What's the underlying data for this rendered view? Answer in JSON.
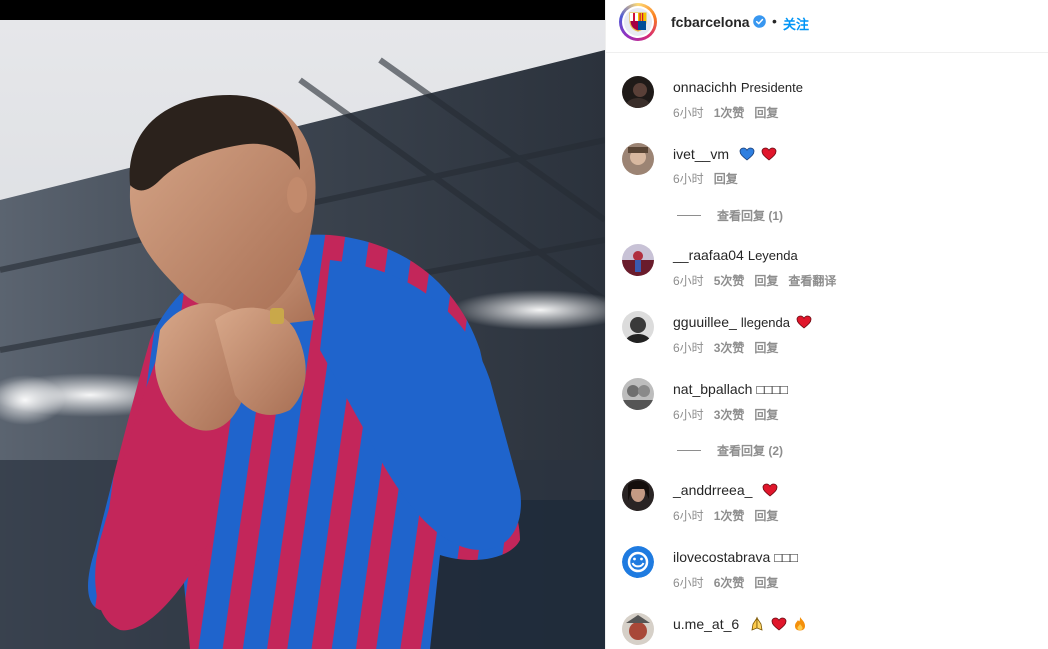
{
  "post": {
    "account": "fcbarcelona",
    "dot": "•",
    "follow_label": "关注"
  },
  "comments": [
    {
      "user": "onnacichh",
      "text": "Presidente",
      "time": "6小时",
      "likes": "1次赞",
      "reply": "回复",
      "avatar_color": "#2b2b2b"
    },
    {
      "user": "ivet__vm",
      "text": "",
      "emojis": [
        "blue-heart",
        "red-heart"
      ],
      "time": "6小时",
      "reply": "回复",
      "avatar_color": "#8a7060",
      "view_replies": "查看回复 (1)"
    },
    {
      "user": "__raafaa04",
      "text": "Leyenda",
      "time": "6小时",
      "likes": "5次赞",
      "reply": "回复",
      "translate": "查看翻译",
      "avatar_color": "#b04040"
    },
    {
      "user": "gguuillee_",
      "text": "llegenda",
      "emojis": [
        "red-heart"
      ],
      "time": "6小时",
      "likes": "3次赞",
      "reply": "回复",
      "avatar_color": "#555555"
    },
    {
      "user": "nat_bpallach",
      "text": "□□□□",
      "time": "6小时",
      "likes": "3次赞",
      "reply": "回复",
      "avatar_color": "#999999",
      "view_replies": "查看回复 (2)"
    },
    {
      "user": "_anddrreea_",
      "text": "",
      "emojis": [
        "red-heart"
      ],
      "time": "6小时",
      "likes": "1次赞",
      "reply": "回复",
      "avatar_color": "#3a3030"
    },
    {
      "user": "ilovecostabrava",
      "text": "□□□",
      "time": "6小时",
      "likes": "6次赞",
      "reply": "回复",
      "avatar_color": "#1f7be0"
    },
    {
      "user": "u.me_at_6",
      "text": "",
      "emojis": [
        "hands",
        "red-heart",
        "fire"
      ],
      "avatar_color": "#c05050"
    }
  ],
  "colors": {
    "accent": "#0095f6",
    "jersey_blue": "#1e63c9",
    "jersey_red": "#c3265a"
  }
}
